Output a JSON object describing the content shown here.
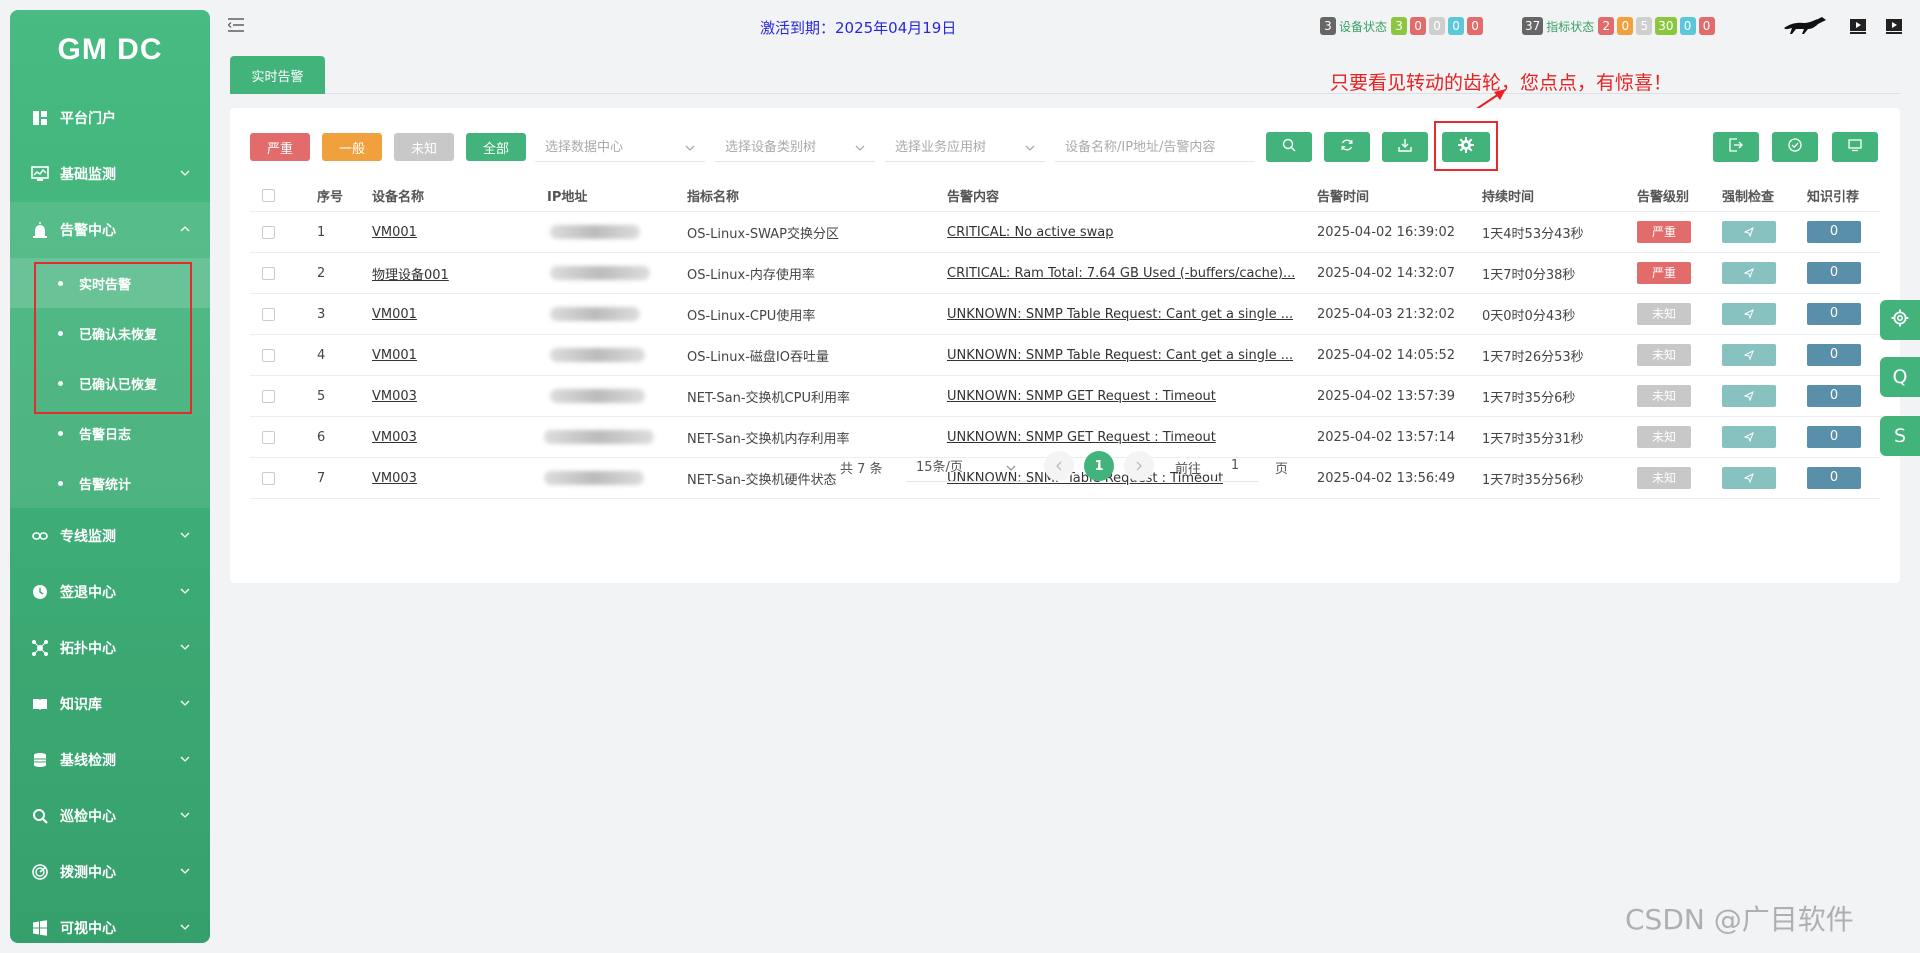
{
  "app": {
    "logo": "GM DC"
  },
  "sidebar": {
    "items": [
      {
        "label": "平台门户"
      },
      {
        "label": "基础监测"
      },
      {
        "label": "告警中心"
      },
      {
        "label": "专线监测"
      },
      {
        "label": "签退中心"
      },
      {
        "label": "拓扑中心"
      },
      {
        "label": "知识库"
      },
      {
        "label": "基线检测"
      },
      {
        "label": "巡检中心"
      },
      {
        "label": "拨测中心"
      },
      {
        "label": "可视中心"
      }
    ],
    "alarm_sub": [
      {
        "label": "实时告警"
      },
      {
        "label": "已确认未恢复"
      },
      {
        "label": "已确认已恢复"
      },
      {
        "label": "告警日志"
      },
      {
        "label": "告警统计"
      }
    ]
  },
  "header": {
    "activation": "激活到期：2025年04月19日",
    "device_status": {
      "total": "3",
      "label": "设备状态",
      "counts": [
        "3",
        "0",
        "0",
        "0",
        "0"
      ]
    },
    "metric_status": {
      "total": "37",
      "label": "指标状态",
      "counts": [
        "2",
        "0",
        "5",
        "30",
        "0",
        "0"
      ]
    }
  },
  "tabs": [
    {
      "label": "实时告警"
    }
  ],
  "annotation": "只要看见转动的齿轮，您点点，有惊喜！",
  "filters": {
    "levels": [
      "严重",
      "一般",
      "未知",
      "全部"
    ],
    "datacenter_placeholder": "选择数据中心",
    "device_type_placeholder": "选择设备类别树",
    "business_placeholder": "选择业务应用树",
    "search_placeholder": "设备名称/IP地址/告警内容"
  },
  "table": {
    "headers": [
      "序号",
      "设备名称",
      "IP地址",
      "指标名称",
      "告警内容",
      "告警时间",
      "持续时间",
      "告警级别",
      "强制检查",
      "知识引荐"
    ],
    "rows": [
      {
        "no": "1",
        "device": "VM001",
        "ip": "",
        "metric": "OS-Linux-SWAP交换分区",
        "content": "CRITICAL: No active swap",
        "time": "2025-04-02 16:39:02",
        "duration": "1天4时53分43秒",
        "level": "严重",
        "knowledge": "0"
      },
      {
        "no": "2",
        "device": "物理设备001",
        "ip": "",
        "metric": "OS-Linux-内存使用率",
        "content": "CRITICAL: Ram Total: 7.64 GB Used (-buffers/cache)...",
        "time": "2025-04-02 14:32:07",
        "duration": "1天7时0分38秒",
        "level": "严重",
        "knowledge": "0"
      },
      {
        "no": "3",
        "device": "VM001",
        "ip": "",
        "metric": "OS-Linux-CPU使用率",
        "content": "UNKNOWN: SNMP Table Request: Cant get a single ...",
        "time": "2025-04-03 21:32:02",
        "duration": "0天0时0分43秒",
        "level": "未知",
        "knowledge": "0"
      },
      {
        "no": "4",
        "device": "VM001",
        "ip": "",
        "metric": "OS-Linux-磁盘IO吞吐量",
        "content": "UNKNOWN: SNMP Table Request: Cant get a single ...",
        "time": "2025-04-02 14:05:52",
        "duration": "1天7时26分53秒",
        "level": "未知",
        "knowledge": "0"
      },
      {
        "no": "5",
        "device": "VM003",
        "ip": "",
        "metric": "NET-San-交换机CPU利用率",
        "content": "UNKNOWN: SNMP GET Request : Timeout",
        "time": "2025-04-02 13:57:39",
        "duration": "1天7时35分6秒",
        "level": "未知",
        "knowledge": "0"
      },
      {
        "no": "6",
        "device": "VM003",
        "ip": "",
        "metric": "NET-San-交换机内存利用率",
        "content": "UNKNOWN: SNMP GET Request : Timeout",
        "time": "2025-04-02 13:57:14",
        "duration": "1天7时35分31秒",
        "level": "未知",
        "knowledge": "0"
      },
      {
        "no": "7",
        "device": "VM003",
        "ip": "",
        "metric": "NET-San-交换机硬件状态",
        "content": "UNKNOWN: SNMP Table Request : Timeout",
        "time": "2025-04-02 13:56:49",
        "duration": "1天7时35分56秒",
        "level": "未知",
        "knowledge": "0"
      }
    ]
  },
  "pagination": {
    "total": "共 7 条",
    "page_size": "15条/页",
    "current": "1",
    "goto_label": "前往",
    "goto_value": "1",
    "page_suffix": "页"
  },
  "float_buttons": [
    "Q",
    "S"
  ],
  "watermark": "CSDN @广目软件",
  "colors": {
    "primary": "#42b47b",
    "critical": "#e26b6b",
    "warning": "#f0a03c",
    "unknown": "#c8c8c8",
    "annotation": "#e62222"
  }
}
